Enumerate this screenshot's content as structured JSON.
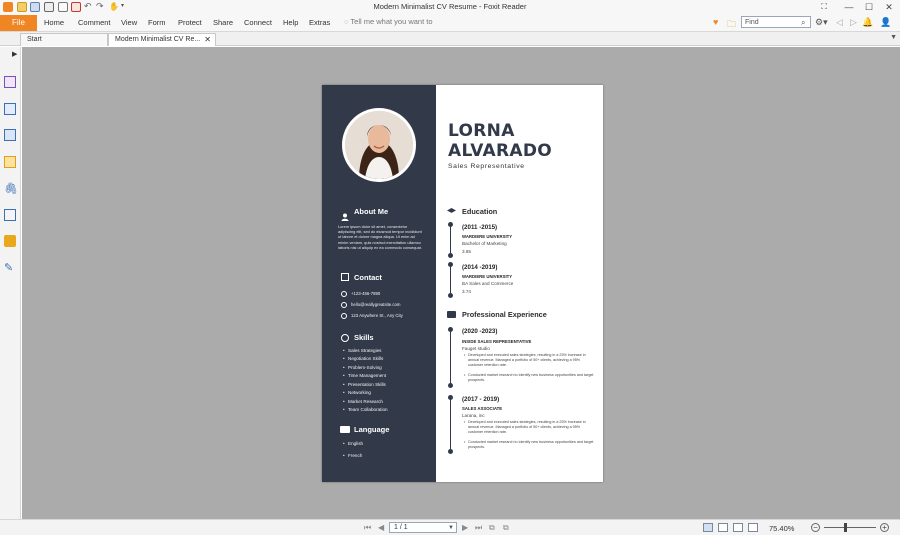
{
  "window": {
    "title": "Modern Minimalist CV Resume - Foxit Reader"
  },
  "menubar": {
    "file": "File",
    "items": [
      "Home",
      "Comment",
      "View",
      "Form",
      "Protect",
      "Share",
      "Connect",
      "Help",
      "Extras"
    ],
    "tell_me": "Tell me what you want to",
    "find_placeholder": "Find"
  },
  "tabs": [
    {
      "label": "Start"
    },
    {
      "label": "Modern Minimalist CV Re..."
    }
  ],
  "resume": {
    "first_name": "LORNA",
    "last_name": "ALVARADO",
    "role": "Sales Representative",
    "about": {
      "title": "About Me",
      "text": "Lorem ipsum dolor sit amet, consectetur adipiscing elit, sed do eiusmod tempor incididunt ut labore et dolore magna aliqua. Ut enim ad minim veniam, quis nostrud exercitation ullamco laboris nisi ut aliquip ex ea commodo consequat."
    },
    "contact": {
      "title": "Contact",
      "phone": "+123-456-7890",
      "email": "hello@reallygreatsite.com",
      "address": "123 Anywhere St., Any City"
    },
    "skills": {
      "title": "Skills",
      "items": [
        "Sales Strategies",
        "Negotiation Skills",
        "Problem-Solving",
        "Time Management",
        "Presentation Skills",
        "Networking",
        "Market Research",
        "Team Collaboration"
      ]
    },
    "language": {
      "title": "Language",
      "items": [
        "English",
        "French"
      ]
    },
    "education": {
      "title": "Education",
      "entries": [
        {
          "date": "(2011 -2015)",
          "org": "WARDIERE UNIVERSITY",
          "degree": "Bachelor of Marketing",
          "gpa": "3.65"
        },
        {
          "date": "(2014 -2019)",
          "org": "WARDIERE UNIVERSITY",
          "degree": "BA Sales and Commerce",
          "gpa": "3.74"
        }
      ]
    },
    "experience": {
      "title": "Professional Experience",
      "entries": [
        {
          "date": "(2020 -2023)",
          "role": "INSIDE SALES REPRESENTATIVE",
          "company": "Fauget studio",
          "bullets": [
            "Developed and executed sales strategies, resulting in a 25% increase in annual revenue. Managed a portfolio of 50+ clients, achieving a 95% customer retention rate.",
            "Conducted market research to identify new business opportunities and target prospects."
          ]
        },
        {
          "date": "(2017 - 2019)",
          "role": "SALES ASSOCIATE",
          "company": "Larana, inc",
          "bullets": [
            "Developed and executed sales strategies, resulting in a 25% increase in annual revenue. Managed a portfolio of 50+ clients, achieving a 95% customer retention rate.",
            "Conducted market research to identify new business opportunities and target prospects."
          ]
        }
      ]
    }
  },
  "statusbar": {
    "page_indicator": "1 / 1",
    "zoom": "75.40%",
    "zoom_level": 0.4
  },
  "colors": {
    "accent": "#f08523",
    "sidebar": "#323a4a",
    "canvas": "#ababab"
  }
}
